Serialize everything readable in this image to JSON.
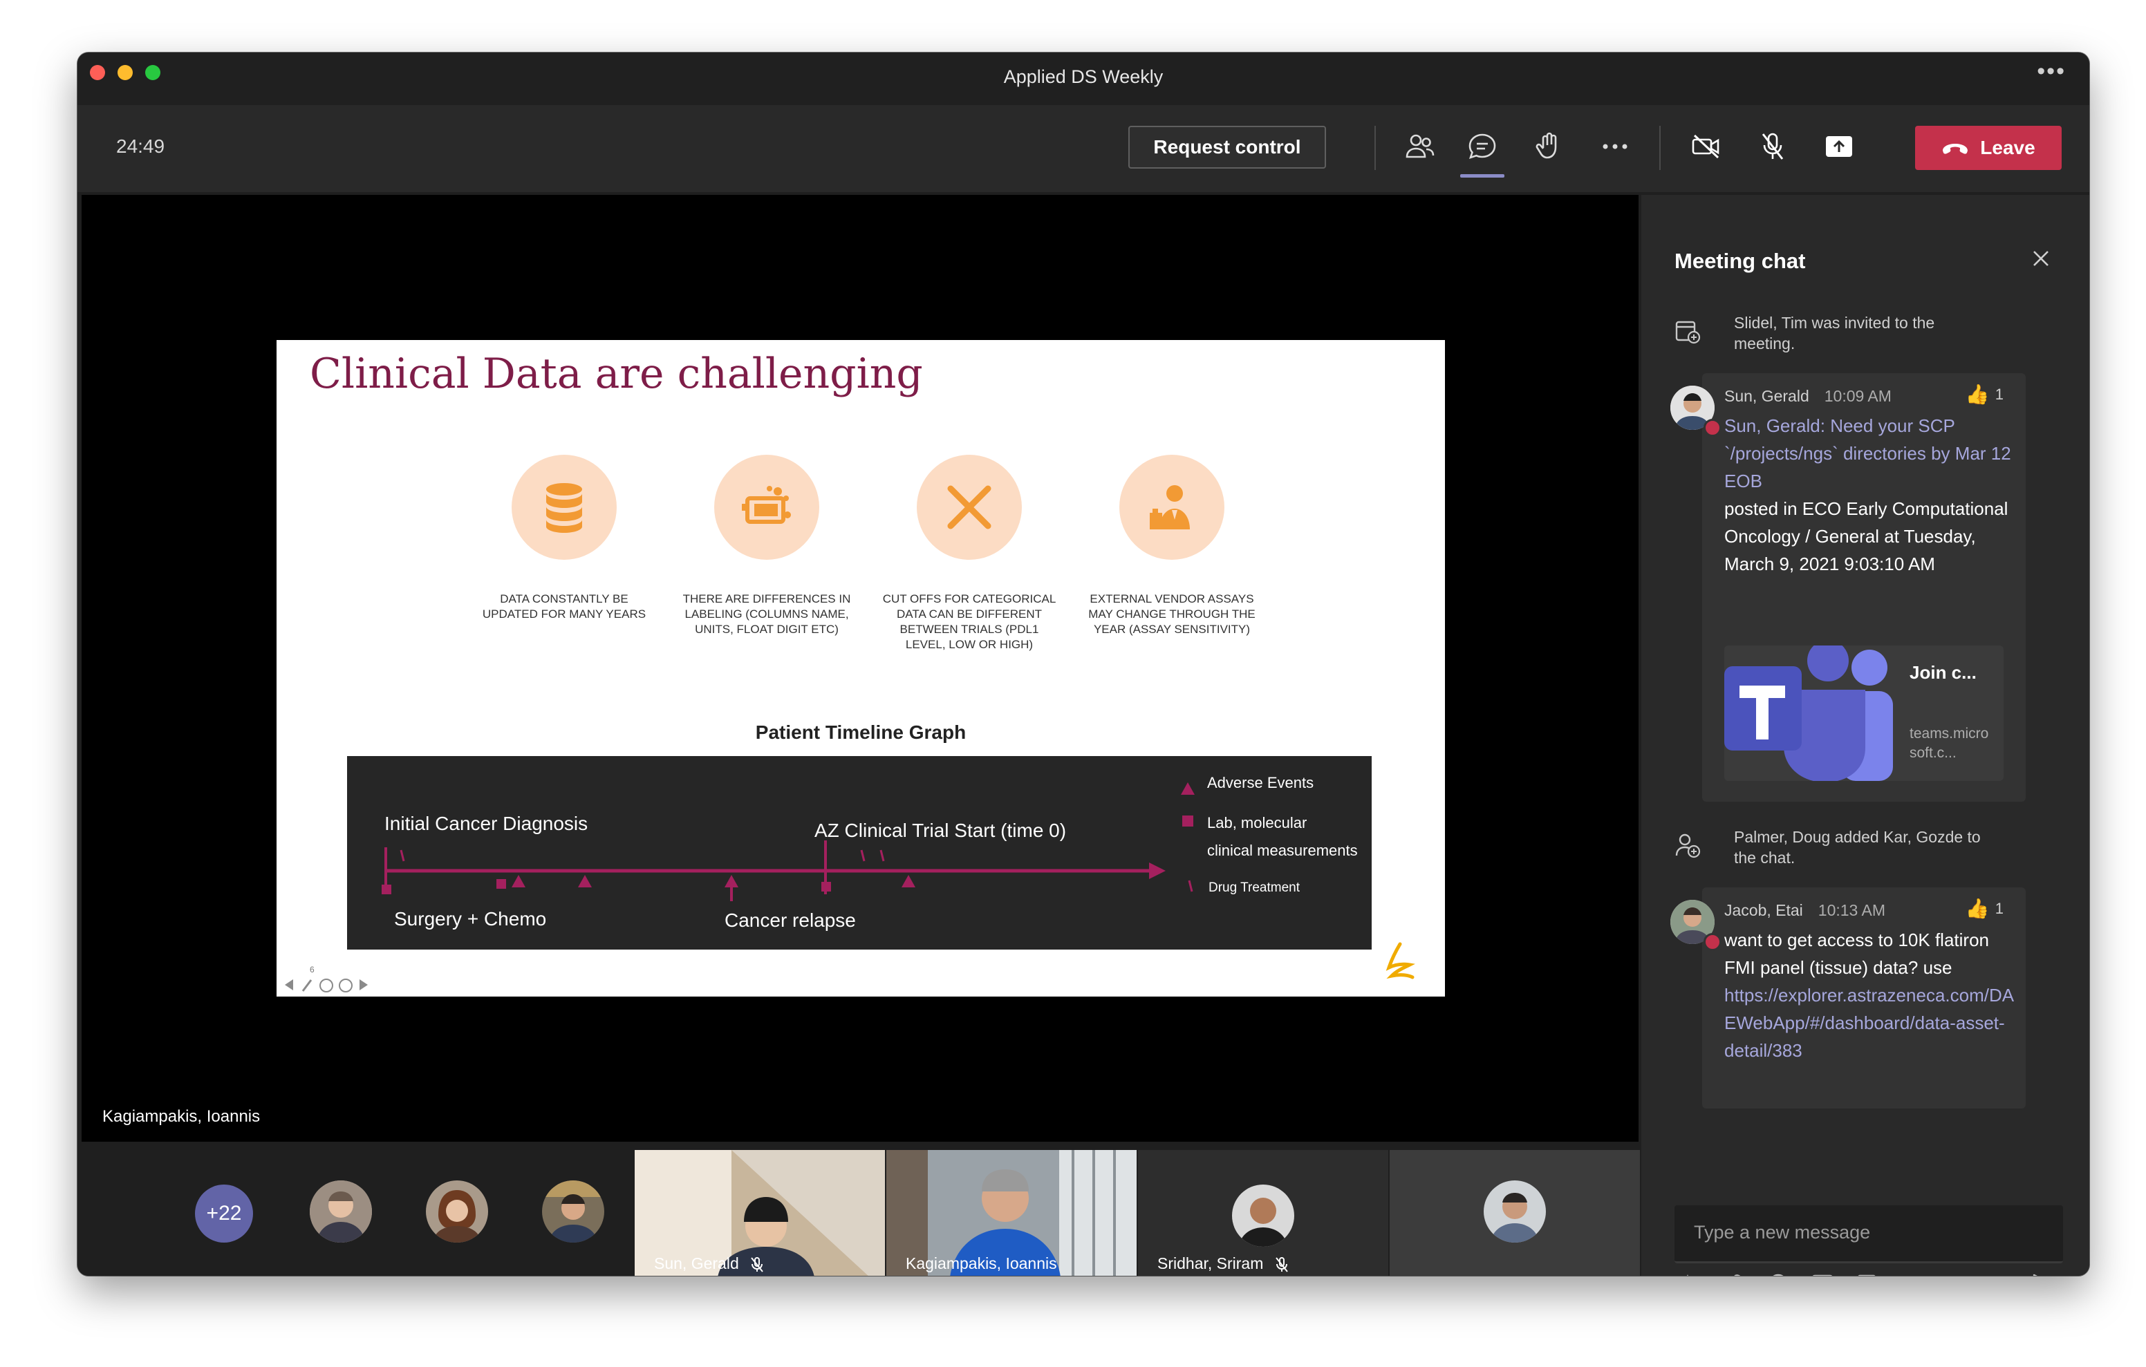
{
  "window": {
    "title": "Applied DS Weekly"
  },
  "toolbar": {
    "timer": "24:49",
    "request_control_label": "Request control",
    "icons": [
      "people-icon",
      "chat-icon",
      "raise-hand-icon",
      "more-icon",
      "camera-off-icon",
      "mic-off-icon",
      "share-screen-icon"
    ],
    "leave_label": "Leave",
    "leave_color": "#c4314b",
    "accent": "#6264a7"
  },
  "slide": {
    "title": "Clinical Data are challenging",
    "title_color": "#7e1d48",
    "challenges": [
      {
        "icon": "database-icon",
        "caption": "DATA CONSTANTLY BE UPDATED FOR MANY YEARS"
      },
      {
        "icon": "data-labeling-icon",
        "caption": "THERE ARE DIFFERENCES IN LABELING (COLUMNS NAME, UNITS, FLOAT DIGIT ETC)"
      },
      {
        "icon": "x-mark-icon",
        "caption": "CUT OFFS FOR CATEGORICAL DATA CAN BE DIFFERENT BETWEEN TRIALS (PDL1 LEVEL, LOW OR HIGH)"
      },
      {
        "icon": "vendor-person-icon",
        "caption": "EXTERNAL VENDOR ASSAYS MAY CHANGE THROUGH THE YEAR (ASSAY SENSITIVITY)"
      }
    ],
    "timeline": {
      "title": "Patient Timeline Graph",
      "labels": {
        "initial_diagnosis": "Initial Cancer Diagnosis",
        "trial_start": "AZ Clinical Trial Start (time 0)",
        "surgery": "Surgery + Chemo",
        "relapse": "Cancer relapse"
      },
      "legend": {
        "adverse": "Adverse Events",
        "lab_line1": "Lab, molecular",
        "lab_line2": "clinical measurements",
        "drug": "Drug Treatment"
      }
    },
    "page_number": "6"
  },
  "stage": {
    "presenter_name": "Kagiampakis, Ioannis"
  },
  "participants": {
    "more_count": "+22",
    "tiles": [
      {
        "name": "Sun, Gerald",
        "muted": true
      },
      {
        "name": "Kagiampakis, Ioannis",
        "muted": false
      },
      {
        "name": "Sridhar, Sriram",
        "muted": true
      }
    ]
  },
  "chat": {
    "title": "Meeting chat",
    "system_1": "Slidel, Tim was invited to the meeting.",
    "msg_1": {
      "author": "Sun, Gerald",
      "time": "10:09 AM",
      "reaction_count": "1",
      "link_text": "Sun, Gerald: Need your SCP `/projects/ngs` directories by Mar 12 EOB",
      "text": "posted in ECO Early Computational Oncology / General at Tuesday, March 9, 2021 9:03:10 AM",
      "card_title": "Join c...",
      "card_url": "teams.microsoft.c..."
    },
    "system_2": "Palmer, Doug added Kar, Gozde to the chat.",
    "msg_2": {
      "author": "Jacob, Etai",
      "time": "10:13 AM",
      "reaction_count": "1",
      "text": "want to get access to 10K flatiron FMI panel (tissue) data? use",
      "link": "https://explorer.astrazeneca.com/DAEWebApp/#/dashboard/data-asset-detail/383"
    },
    "compose_placeholder": "Type a new message",
    "compose_icons": [
      "format-icon",
      "attach-icon",
      "emoji-icon",
      "gif-icon",
      "sticker-icon",
      "more-options-icon",
      "send-icon"
    ]
  }
}
